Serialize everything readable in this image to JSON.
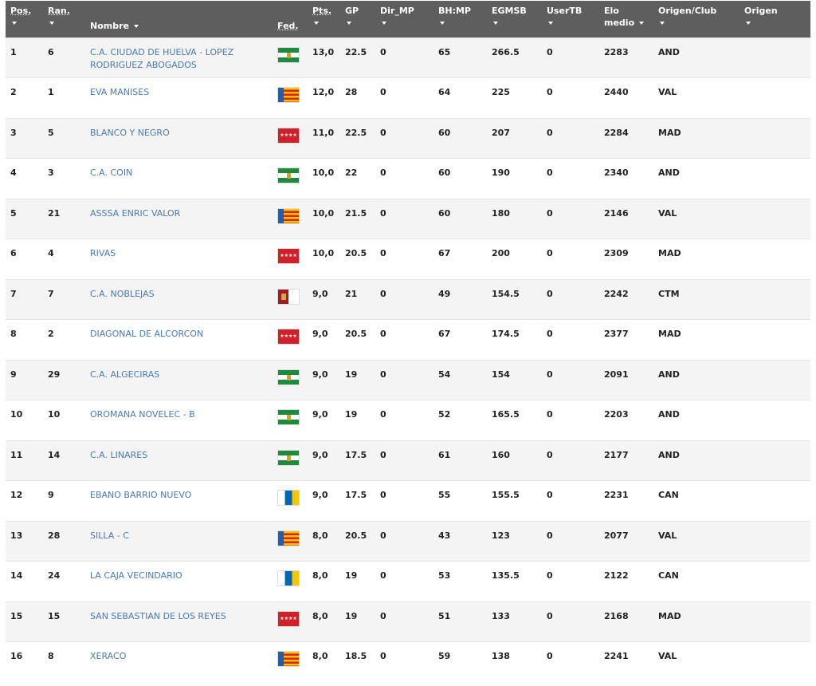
{
  "header": {
    "pos": "Pos.",
    "ran": "Ran.",
    "nombre": "Nombre",
    "fed": "Fed.",
    "pts": "Pts.",
    "gp": "GP",
    "dir_mp": "Dir_MP",
    "bh_mp": "BH:MP",
    "egmsb": "EGMSB",
    "usertb": "UserTB",
    "elo_line1": "Elo",
    "elo_line2": "medio",
    "origen_club": "Origen/Club",
    "origen": "Origen"
  },
  "madrid_stars": "★★★★",
  "flag_colors": {
    "AND": "#1e8a3e",
    "VAL": "#f5c400",
    "MAD": "#d0202a",
    "CTM": "#a11a28",
    "CAN": "#0067b1"
  },
  "rows": [
    {
      "pos": "1",
      "ran": "6",
      "name": "C.A. CIUDAD DE HUELVA - LOPEZ RODRIGUEZ ABOGADOS",
      "fed": "AND",
      "pts": "13,0",
      "gp": "22.5",
      "dir_mp": "0",
      "bh_mp": "65",
      "egmsb": "266.5",
      "usertb": "0",
      "elo": "2283",
      "origen": "AND"
    },
    {
      "pos": "2",
      "ran": "1",
      "name": "EVA MANISES",
      "fed": "VAL",
      "pts": "12,0",
      "gp": "28",
      "dir_mp": "0",
      "bh_mp": "64",
      "egmsb": "225",
      "usertb": "0",
      "elo": "2440",
      "origen": "VAL"
    },
    {
      "pos": "3",
      "ran": "5",
      "name": "BLANCO Y NEGRO",
      "fed": "MAD",
      "pts": "11,0",
      "gp": "22.5",
      "dir_mp": "0",
      "bh_mp": "60",
      "egmsb": "207",
      "usertb": "0",
      "elo": "2284",
      "origen": "MAD"
    },
    {
      "pos": "4",
      "ran": "3",
      "name": "C.A. COIN",
      "fed": "AND",
      "pts": "10,0",
      "gp": "22",
      "dir_mp": "0",
      "bh_mp": "60",
      "egmsb": "190",
      "usertb": "0",
      "elo": "2340",
      "origen": "AND"
    },
    {
      "pos": "5",
      "ran": "21",
      "name": "ASSSA ENRIC VALOR",
      "fed": "VAL",
      "pts": "10,0",
      "gp": "21.5",
      "dir_mp": "0",
      "bh_mp": "60",
      "egmsb": "180",
      "usertb": "0",
      "elo": "2146",
      "origen": "VAL"
    },
    {
      "pos": "6",
      "ran": "4",
      "name": "RIVAS",
      "fed": "MAD",
      "pts": "10,0",
      "gp": "20.5",
      "dir_mp": "0",
      "bh_mp": "67",
      "egmsb": "200",
      "usertb": "0",
      "elo": "2309",
      "origen": "MAD"
    },
    {
      "pos": "7",
      "ran": "7",
      "name": "C.A. NOBLEJAS",
      "fed": "CTM",
      "pts": "9,0",
      "gp": "21",
      "dir_mp": "0",
      "bh_mp": "49",
      "egmsb": "154.5",
      "usertb": "0",
      "elo": "2242",
      "origen": "CTM"
    },
    {
      "pos": "8",
      "ran": "2",
      "name": "DIAGONAL DE ALCORCON",
      "fed": "MAD",
      "pts": "9,0",
      "gp": "20.5",
      "dir_mp": "0",
      "bh_mp": "67",
      "egmsb": "174.5",
      "usertb": "0",
      "elo": "2377",
      "origen": "MAD"
    },
    {
      "pos": "9",
      "ran": "29",
      "name": "C.A. ALGECIRAS",
      "fed": "AND",
      "pts": "9,0",
      "gp": "19",
      "dir_mp": "0",
      "bh_mp": "54",
      "egmsb": "154",
      "usertb": "0",
      "elo": "2091",
      "origen": "AND"
    },
    {
      "pos": "10",
      "ran": "10",
      "name": "OROMANA NOVELEC - B",
      "fed": "AND",
      "pts": "9,0",
      "gp": "19",
      "dir_mp": "0",
      "bh_mp": "52",
      "egmsb": "165.5",
      "usertb": "0",
      "elo": "2203",
      "origen": "AND"
    },
    {
      "pos": "11",
      "ran": "14",
      "name": "C.A. LINARES",
      "fed": "AND",
      "pts": "9,0",
      "gp": "17.5",
      "dir_mp": "0",
      "bh_mp": "61",
      "egmsb": "160",
      "usertb": "0",
      "elo": "2177",
      "origen": "AND"
    },
    {
      "pos": "12",
      "ran": "9",
      "name": "EBANO BARRIO NUEVO",
      "fed": "CAN",
      "pts": "9,0",
      "gp": "17.5",
      "dir_mp": "0",
      "bh_mp": "55",
      "egmsb": "155.5",
      "usertb": "0",
      "elo": "2231",
      "origen": "CAN"
    },
    {
      "pos": "13",
      "ran": "28",
      "name": "SILLA - C",
      "fed": "VAL",
      "pts": "8,0",
      "gp": "20.5",
      "dir_mp": "0",
      "bh_mp": "43",
      "egmsb": "123",
      "usertb": "0",
      "elo": "2077",
      "origen": "VAL"
    },
    {
      "pos": "14",
      "ran": "24",
      "name": "LA CAJA VECINDARIO",
      "fed": "CAN",
      "pts": "8,0",
      "gp": "19",
      "dir_mp": "0",
      "bh_mp": "53",
      "egmsb": "135.5",
      "usertb": "0",
      "elo": "2122",
      "origen": "CAN"
    },
    {
      "pos": "15",
      "ran": "15",
      "name": "SAN SEBASTIAN DE LOS REYES",
      "fed": "MAD",
      "pts": "8,0",
      "gp": "19",
      "dir_mp": "0",
      "bh_mp": "51",
      "egmsb": "133",
      "usertb": "0",
      "elo": "2168",
      "origen": "MAD"
    },
    {
      "pos": "16",
      "ran": "8",
      "name": "XERACO",
      "fed": "VAL",
      "pts": "8,0",
      "gp": "18.5",
      "dir_mp": "0",
      "bh_mp": "59",
      "egmsb": "138",
      "usertb": "0",
      "elo": "2241",
      "origen": "VAL"
    }
  ]
}
